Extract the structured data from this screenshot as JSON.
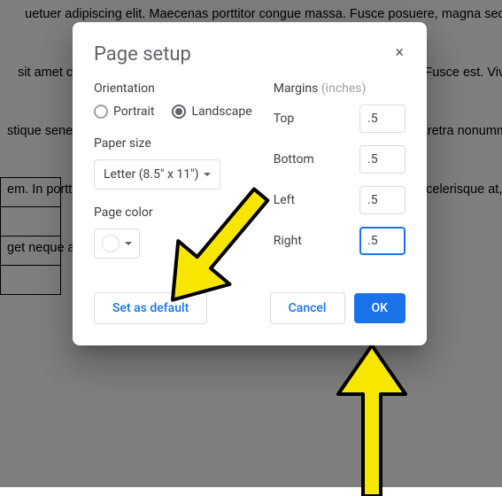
{
  "background": {
    "text": "     uetuer adipiscing elit. Maecenas porttitor congue massa. Fusce posuere, magna sed pulv\n\n   sit amet commodo magna eros quis urna. Nunc viverra imperdiet enim. Fusce est. Viva\n\nstique senectus et netus et malesuada fames ac turpis egestas. Proin pharetra nonumm\n\nem. In porttitor. Donec laoreet nonummy augue. Suspendisse dui purus, scelerisque at, v\n\nget neque at sem venenatis eleifend. Ut nonummy."
  },
  "dialog": {
    "title": "Page setup",
    "close_icon": "×",
    "orientation": {
      "label": "Orientation",
      "portrait": "Portrait",
      "landscape": "Landscape",
      "selected": "landscape"
    },
    "paper_size": {
      "label": "Paper size",
      "value": "Letter (8.5\" x 11\")"
    },
    "page_color": {
      "label": "Page color",
      "value": "#ffffff"
    },
    "margins": {
      "label": "Margins",
      "unit": "(inches)",
      "top": {
        "label": "Top",
        "value": ".5"
      },
      "bottom": {
        "label": "Bottom",
        "value": ".5"
      },
      "left": {
        "label": "Left",
        "value": ".5"
      },
      "right": {
        "label": "Right",
        "value": ".5",
        "focused": true
      }
    },
    "actions": {
      "set_default": "Set as default",
      "cancel": "Cancel",
      "ok": "OK"
    }
  }
}
